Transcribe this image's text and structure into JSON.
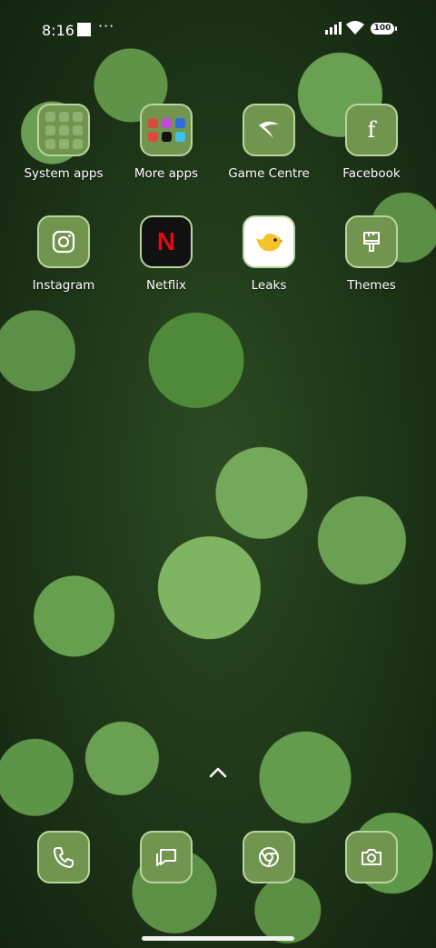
{
  "status_bar": {
    "time": "8:16",
    "notifications": "···",
    "battery": "100"
  },
  "apps": [
    {
      "label": "System apps",
      "icon": "folder-system-icon"
    },
    {
      "label": "More apps",
      "icon": "folder-more-icon"
    },
    {
      "label": "Game Centre",
      "icon": "boomerang-icon"
    },
    {
      "label": "Facebook",
      "icon": "facebook-icon"
    },
    {
      "label": "Instagram",
      "icon": "instagram-icon"
    },
    {
      "label": "Netflix",
      "icon": "netflix-icon"
    },
    {
      "label": "Leaks",
      "icon": "bird-icon"
    },
    {
      "label": "Themes",
      "icon": "paintbrush-icon"
    }
  ],
  "dock": [
    {
      "icon": "phone-icon"
    },
    {
      "icon": "messages-icon"
    },
    {
      "icon": "chrome-icon"
    },
    {
      "icon": "camera-icon"
    }
  ],
  "colors": {
    "icon_fill": "#71944f",
    "icon_border": "#b9d59e",
    "netflix_red": "#e50914",
    "leaks_yellow": "#f6c22c"
  }
}
